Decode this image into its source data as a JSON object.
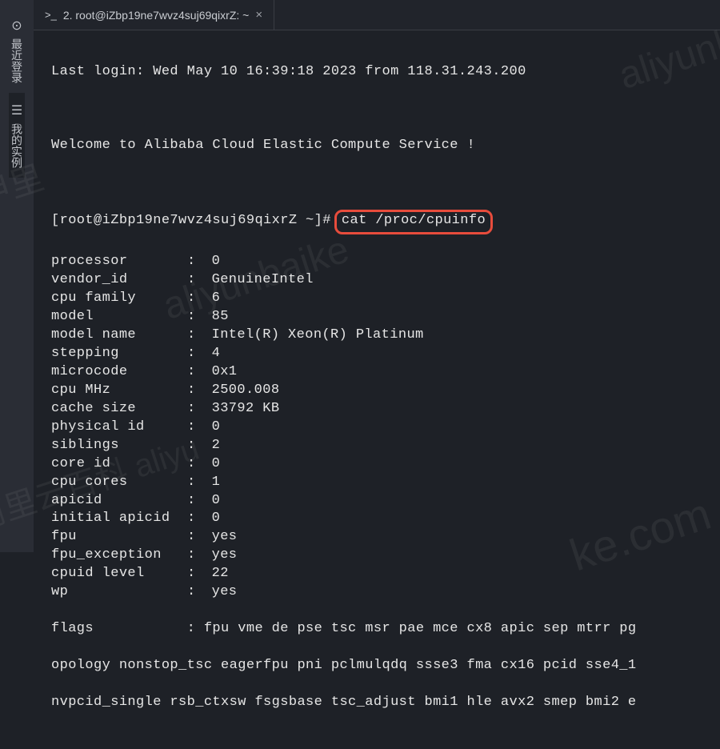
{
  "sidebar": {
    "recent_login": {
      "label": "最近登录",
      "icon": "⊙"
    },
    "my_instance": {
      "label": "我的实例",
      "icon": "☰"
    }
  },
  "tab": {
    "prefix_icon": ">_",
    "title": "2. root@iZbp19ne7wvz4suj69qixrZ: ~",
    "close_icon": "×"
  },
  "terminal": {
    "last_login": "Last login: Wed May 10 16:39:18 2023 from 118.31.243.200",
    "welcome": "Welcome to Alibaba Cloud Elastic Compute Service !",
    "prompt_user": "[root@iZbp19ne7wvz4suj69qixrZ ~]#",
    "command": "cat /proc/cpuinfo",
    "cpuinfo": [
      {
        "k": "processor",
        "v": "0"
      },
      {
        "k": "vendor_id",
        "v": "GenuineIntel"
      },
      {
        "k": "cpu family",
        "v": "6"
      },
      {
        "k": "model",
        "v": "85"
      },
      {
        "k": "model name",
        "v": "Intel(R) Xeon(R) Platinum"
      },
      {
        "k": "stepping",
        "v": "4"
      },
      {
        "k": "microcode",
        "v": "0x1"
      },
      {
        "k": "cpu MHz",
        "v": "2500.008"
      },
      {
        "k": "cache size",
        "v": "33792 KB"
      },
      {
        "k": "physical id",
        "v": "0"
      },
      {
        "k": "siblings",
        "v": "2"
      },
      {
        "k": "core id",
        "v": "0"
      },
      {
        "k": "cpu cores",
        "v": "1"
      },
      {
        "k": "apicid",
        "v": "0"
      },
      {
        "k": "initial apicid",
        "v": "0"
      },
      {
        "k": "fpu",
        "v": "yes"
      },
      {
        "k": "fpu_exception",
        "v": "yes"
      },
      {
        "k": "cpuid level",
        "v": "22"
      },
      {
        "k": "wp",
        "v": "yes"
      }
    ],
    "flags_line1": "flags           : fpu vme de pse tsc msr pae mce cx8 apic sep mtrr pg",
    "flags_line2": "opology nonstop_tsc eagerfpu pni pclmulqdq ssse3 fma cx16 pcid sse4_1",
    "flags_line3": "nvpcid_single rsb_ctxsw fsgsbase tsc_adjust bmi1 hle avx2 smep bmi2 e"
  },
  "watermarks": {
    "w1": "aliyunbai",
    "w2": "aliyunbaike",
    "w3": "ke.com",
    "w4": "阿里云百科 aliyu",
    "w5": "甲里"
  }
}
